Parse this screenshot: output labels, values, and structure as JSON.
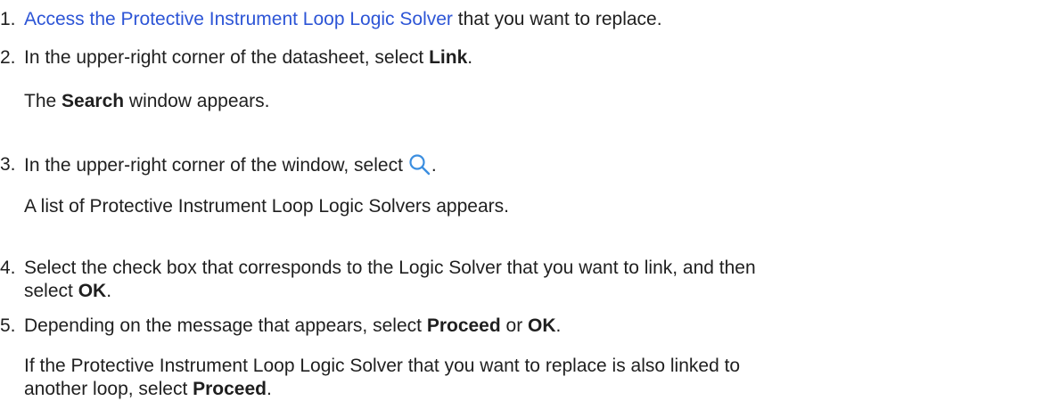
{
  "steps": [
    {
      "number": "1.",
      "link_text": "Access the Protective Instrument Loop Logic Solver",
      "text_after": " that you want to replace."
    },
    {
      "number": "2.",
      "text_before": "In the upper-right corner of the datasheet, select ",
      "bold": "Link",
      "text_after": ".",
      "result_before": "The ",
      "result_bold": "Search",
      "result_after": " window appears."
    },
    {
      "number": "3.",
      "text_before": "In the upper-right corner of the window, select",
      "icon": "search-icon",
      "text_after": ".",
      "result": "A list of Protective Instrument Loop Logic Solvers appears."
    },
    {
      "number": "4.",
      "line1": "Select the check box that corresponds to the Logic Solver that you want to link, and then",
      "line2_before": "select ",
      "line2_bold": "OK",
      "line2_after": "."
    },
    {
      "number": "5.",
      "text_before": "Depending on the message that appears, select ",
      "bold1": "Proceed",
      "text_mid": " or ",
      "bold2": "OK",
      "text_after": ".",
      "note_line1": "If the Protective Instrument Loop Logic Solver that you want to replace is also linked to",
      "note_line2_before": "another loop, select ",
      "note_line2_bold": "Proceed",
      "note_line2_after": "."
    }
  ],
  "colors": {
    "link": "#2d55d6",
    "text": "#1f1f1f",
    "icon": "#3b8ee0"
  }
}
